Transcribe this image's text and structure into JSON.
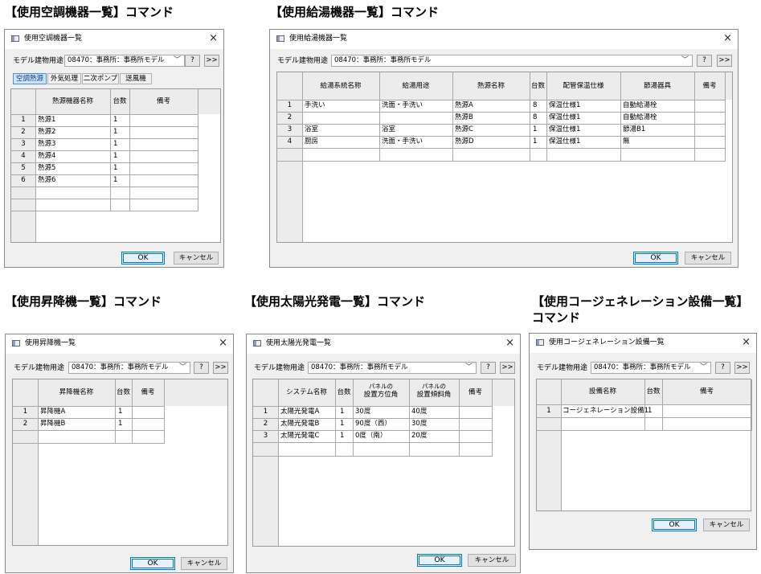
{
  "headings": {
    "ac": "【使用空調機器一覧】コマンド",
    "hw": "【使用給湯機器一覧】コマンド",
    "ev": "【使用昇降機一覧】コマンド",
    "pv": "【使用太陽光発電一覧】コマンド",
    "cg_line1": "【使用コージェネレーション設備一覧】",
    "cg_line2": "コマンド"
  },
  "common": {
    "model_label": "モデル建物用途",
    "model_value": "08470：事務所：事務所モデル",
    "help_btn": "?",
    "expand_btn": ">>",
    "ok": "OK",
    "cancel": "キャンセル",
    "close": "×"
  },
  "ac": {
    "title": "使用空調機器一覧",
    "tabs": [
      "空調熱源",
      "外気処理",
      "二次ポンプ",
      "送風機"
    ],
    "columns": [
      "熱源機器名称",
      "台数",
      "備考"
    ],
    "rows": [
      [
        "1",
        "熱源1",
        "1",
        ""
      ],
      [
        "2",
        "熱源2",
        "1",
        ""
      ],
      [
        "3",
        "熱源3",
        "1",
        ""
      ],
      [
        "4",
        "熱源4",
        "1",
        ""
      ],
      [
        "5",
        "熱源5",
        "1",
        ""
      ],
      [
        "6",
        "熱源6",
        "1",
        ""
      ]
    ]
  },
  "hw": {
    "title": "使用給湯機器一覧",
    "columns": [
      "給湯系統名称",
      "給湯用途",
      "熱源名称",
      "台数",
      "配管保温仕様",
      "節湯器具",
      "備考"
    ],
    "rows": [
      [
        "1",
        "手洗い",
        "洗面・手洗い",
        "熱源A",
        "8",
        "保温仕様1",
        "自動給湯栓",
        ""
      ],
      [
        "2",
        "",
        "",
        "熱源B",
        "8",
        "保温仕様1",
        "自動給湯栓",
        ""
      ],
      [
        "3",
        "浴室",
        "浴室",
        "熱源C",
        "1",
        "保温仕様1",
        "節湯B1",
        ""
      ],
      [
        "4",
        "厨房",
        "洗面・手洗い",
        "熱源D",
        "1",
        "保温仕様1",
        "無",
        ""
      ]
    ]
  },
  "ev": {
    "title": "使用昇降機一覧",
    "columns": [
      "昇降機名称",
      "台数",
      "備考"
    ],
    "rows": [
      [
        "1",
        "昇降機A",
        "1",
        ""
      ],
      [
        "2",
        "昇降機B",
        "1",
        ""
      ]
    ]
  },
  "pv": {
    "title": "使用太陽光発電一覧",
    "columns": [
      "システム名称",
      "台数",
      "パネルの設置方位角",
      "パネルの設置傾斜角",
      "備考"
    ],
    "col_line1": [
      "",
      "",
      "パネルの",
      "パネルの",
      ""
    ],
    "col_line2": [
      "システム名称",
      "台数",
      "設置方位角",
      "設置傾斜角",
      "備考"
    ],
    "rows": [
      [
        "1",
        "太陽光発電A",
        "1",
        "30度",
        "40度",
        ""
      ],
      [
        "2",
        "太陽光発電B",
        "1",
        "90度（西）",
        "30度",
        ""
      ],
      [
        "3",
        "太陽光発電C",
        "1",
        "0度（南）",
        "20度",
        ""
      ]
    ]
  },
  "cg": {
    "title": "使用コージェネレーション設備一覧",
    "columns": [
      "設備名称",
      "台数",
      "備考"
    ],
    "rows": [
      [
        "1",
        "コージェネレーション設備1",
        "1",
        ""
      ]
    ]
  }
}
